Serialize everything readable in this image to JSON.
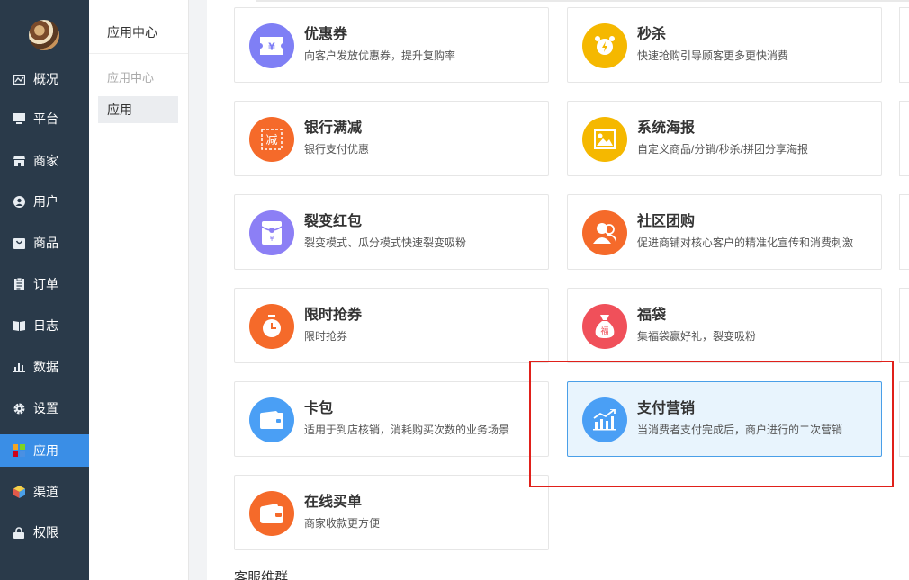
{
  "sidebar": {
    "items": [
      {
        "label": "概况",
        "icon": "overview-icon",
        "active": false
      },
      {
        "label": "平台",
        "icon": "platform-icon",
        "active": false
      },
      {
        "label": "商家",
        "icon": "store-icon",
        "active": false
      },
      {
        "label": "用户",
        "icon": "user-icon",
        "active": false
      },
      {
        "label": "商品",
        "icon": "goods-icon",
        "active": false
      },
      {
        "label": "订单",
        "icon": "order-icon",
        "active": false
      },
      {
        "label": "日志",
        "icon": "log-icon",
        "active": false
      },
      {
        "label": "数据",
        "icon": "data-icon",
        "active": false
      },
      {
        "label": "设置",
        "icon": "settings-icon",
        "active": false
      },
      {
        "label": "应用",
        "icon": "apps-icon",
        "active": true
      },
      {
        "label": "渠道",
        "icon": "channel-icon",
        "active": false
      },
      {
        "label": "权限",
        "icon": "lock-icon",
        "active": false
      }
    ]
  },
  "submenu": {
    "title": "应用中心",
    "group": "应用中心",
    "item": "应用"
  },
  "cards": [
    {
      "title": "优惠券",
      "desc": "向客户发放优惠券，提升复购率",
      "icon": "coupon-icon",
      "color": "#7f7ff5"
    },
    {
      "title": "秒杀",
      "desc": "快速抢购引导顾客更多更快消费",
      "icon": "alarm-clock-icon",
      "color": "#f5b800"
    },
    {
      "title": "银行满减",
      "desc": "银行支付优惠",
      "icon": "discount-icon",
      "color": "#f56a2a"
    },
    {
      "title": "系统海报",
      "desc": "自定义商品/分销/秒杀/拼团分享海报",
      "icon": "poster-icon",
      "color": "#f5b800"
    },
    {
      "title": "裂变红包",
      "desc": "裂变模式、瓜分模式快速裂变吸粉",
      "icon": "red-envelope-icon",
      "color": "#8c7ff5"
    },
    {
      "title": "社区团购",
      "desc": "促进商铺对核心客户的精准化宣传和消费刺激",
      "icon": "community-icon",
      "color": "#f56a2a"
    },
    {
      "title": "限时抢券",
      "desc": "限时抢券",
      "icon": "timer-icon",
      "color": "#f56a2a"
    },
    {
      "title": "福袋",
      "desc": "集福袋赢好礼，裂变吸粉",
      "icon": "lucky-bag-icon",
      "color": "#f0505a"
    },
    {
      "title": "卡包",
      "desc": "适用于到店核销，消耗购买次数的业务场景",
      "icon": "card-wallet-icon",
      "color": "#4a9ff5"
    },
    {
      "title": "支付营销",
      "desc": "当消费者支付完成后，商户进行的二次营销",
      "icon": "growth-chart-icon",
      "color": "#4a9ff5"
    },
    {
      "title": "在线买单",
      "desc": "商家收款更方便",
      "icon": "wallet-icon",
      "color": "#f56a2a"
    }
  ],
  "icon_glyphs": {
    "coupon": "¥",
    "discount": "减",
    "lucky_bag": "福"
  },
  "section_label": "客服维群"
}
